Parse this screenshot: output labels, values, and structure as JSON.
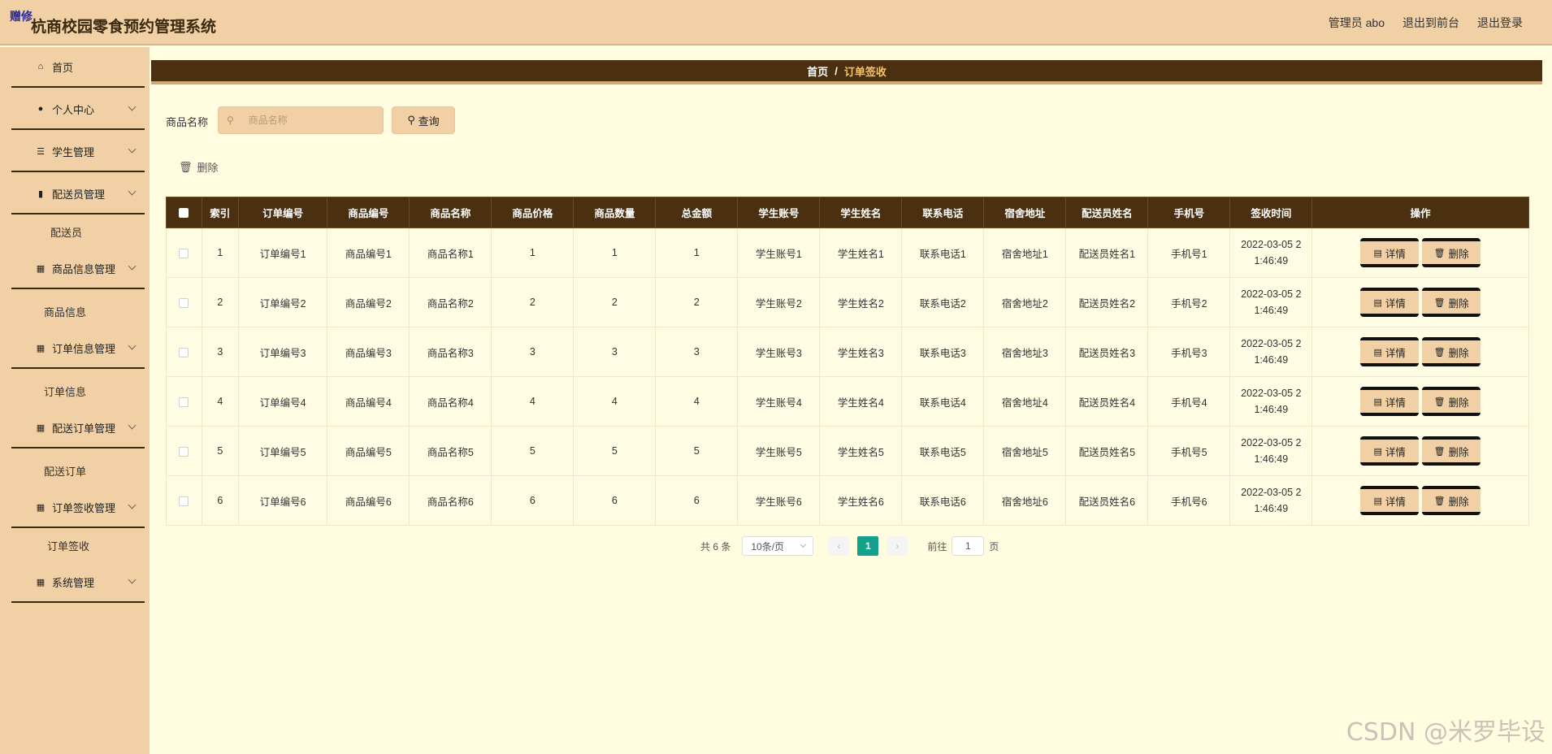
{
  "header": {
    "badge": "赠修",
    "title": "杭商校园零食预约管理系统",
    "admin": "管理员 abo",
    "back_to_front": "退出到前台",
    "logout": "退出登录"
  },
  "sidebar": {
    "menus": [
      {
        "label": "首页",
        "icon": "home-icon"
      },
      {
        "label": "个人中心",
        "icon": "user-icon"
      },
      {
        "label": "学生管理",
        "icon": "list-icon"
      },
      {
        "label": "配送员管理",
        "icon": "bar-icon"
      },
      {
        "label": "商品信息管理",
        "icon": "grid-icon"
      },
      {
        "label": "订单信息管理",
        "icon": "grid-icon"
      },
      {
        "label": "配送订单管理",
        "icon": "grid-icon"
      },
      {
        "label": "订单签收管理",
        "icon": "grid-icon"
      },
      {
        "label": "系统管理",
        "icon": "grid-icon"
      }
    ],
    "subs": [
      "配送员",
      "商品信息",
      "订单信息",
      "配送订单",
      "订单签收"
    ]
  },
  "breadcrumb": {
    "home": "首页",
    "sep": "/",
    "current": "订单签收"
  },
  "search": {
    "label": "商品名称",
    "placeholder": "商品名称",
    "button": "查询"
  },
  "actions": {
    "delete": "删除"
  },
  "table": {
    "headers": [
      "索引",
      "订单编号",
      "商品编号",
      "商品名称",
      "商品价格",
      "商品数量",
      "总金额",
      "学生账号",
      "学生姓名",
      "联系电话",
      "宿舍地址",
      "配送员姓名",
      "手机号",
      "签收时间",
      "操作"
    ],
    "rows": [
      [
        "1",
        "订单编号1",
        "商品编号1",
        "商品名称1",
        "1",
        "1",
        "1",
        "学生账号1",
        "学生姓名1",
        "联系电话1",
        "宿舍地址1",
        "配送员姓名1",
        "手机号1",
        "2022-03-05 21:46:49"
      ],
      [
        "2",
        "订单编号2",
        "商品编号2",
        "商品名称2",
        "2",
        "2",
        "2",
        "学生账号2",
        "学生姓名2",
        "联系电话2",
        "宿舍地址2",
        "配送员姓名2",
        "手机号2",
        "2022-03-05 21:46:49"
      ],
      [
        "3",
        "订单编号3",
        "商品编号3",
        "商品名称3",
        "3",
        "3",
        "3",
        "学生账号3",
        "学生姓名3",
        "联系电话3",
        "宿舍地址3",
        "配送员姓名3",
        "手机号3",
        "2022-03-05 21:46:49"
      ],
      [
        "4",
        "订单编号4",
        "商品编号4",
        "商品名称4",
        "4",
        "4",
        "4",
        "学生账号4",
        "学生姓名4",
        "联系电话4",
        "宿舍地址4",
        "配送员姓名4",
        "手机号4",
        "2022-03-05 21:46:49"
      ],
      [
        "5",
        "订单编号5",
        "商品编号5",
        "商品名称5",
        "5",
        "5",
        "5",
        "学生账号5",
        "学生姓名5",
        "联系电话5",
        "宿舍地址5",
        "配送员姓名5",
        "手机号5",
        "2022-03-05 21:46:49"
      ],
      [
        "6",
        "订单编号6",
        "商品编号6",
        "商品名称6",
        "6",
        "6",
        "6",
        "学生账号6",
        "学生姓名6",
        "联系电话6",
        "宿舍地址6",
        "配送员姓名6",
        "手机号6",
        "2022-03-05 21:46:49"
      ]
    ],
    "time_lines": [
      "2022-03-05 2",
      "1:46:49"
    ],
    "op_detail": "详情",
    "op_delete": "删除"
  },
  "pagination": {
    "total": "共 6 条",
    "page_size": "10条/页",
    "current_page": "1",
    "goto_label": "前往",
    "goto_value": "1",
    "goto_suffix": "页"
  },
  "watermark": "CSDN @米罗毕设",
  "colors": {
    "header_bg": "#f0d0a4",
    "dark_brown": "#4a3011",
    "page_bg": "#fffce0",
    "accent_green": "#12a289",
    "crumb_current": "#f6c36b"
  }
}
